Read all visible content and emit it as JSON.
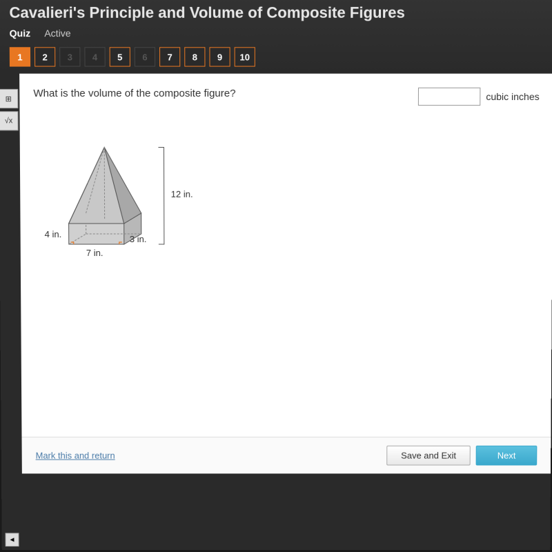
{
  "header": {
    "title": "Cavalieri's Principle and Volume of Composite Figures",
    "tabs": [
      {
        "label": "Quiz",
        "active": true
      },
      {
        "label": "Active",
        "active": false
      }
    ]
  },
  "questionNav": [
    {
      "label": "1",
      "state": "current"
    },
    {
      "label": "2",
      "state": "visited"
    },
    {
      "label": "3",
      "state": "faded"
    },
    {
      "label": "4",
      "state": "faded"
    },
    {
      "label": "5",
      "state": "visited"
    },
    {
      "label": "6",
      "state": "faded"
    },
    {
      "label": "7",
      "state": "visited"
    },
    {
      "label": "8",
      "state": "visited"
    },
    {
      "label": "9",
      "state": "visited"
    },
    {
      "label": "10",
      "state": "visited"
    }
  ],
  "sidebar": {
    "tools": [
      {
        "name": "calculator-tool",
        "icon": "⊞"
      },
      {
        "name": "sqrt-tool",
        "icon": "√x"
      }
    ]
  },
  "question": {
    "text": "What is the volume of the composite figure?",
    "unit": "cubic inches"
  },
  "figure": {
    "dimensions": {
      "heightTotal": "12 in.",
      "depth": "4 in.",
      "prismHeight": "3 in.",
      "width": "7 in."
    }
  },
  "footer": {
    "markLink": "Mark this and return",
    "saveBtn": "Save and Exit",
    "nextBtn": "Next"
  },
  "scrollBtn": "◄"
}
